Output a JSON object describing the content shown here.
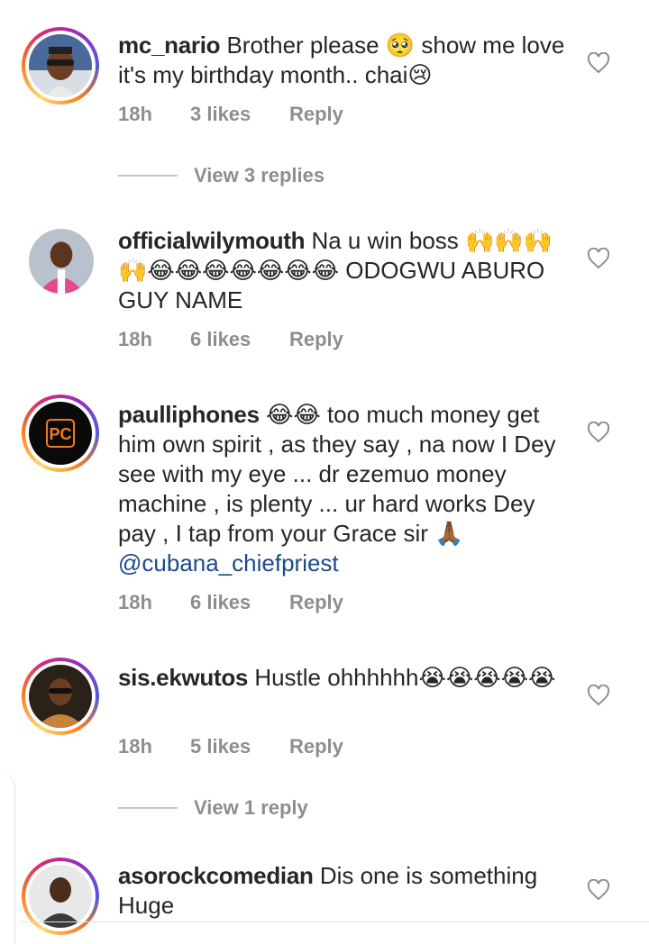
{
  "comments": [
    {
      "username": "mc_nario",
      "text": " Brother please 🥺 show me love it's my birthday month.. chai😢",
      "time": "18h",
      "likes": "3 likes",
      "reply": "Reply",
      "has_story_ring": true
    },
    {
      "username": "officialwilymouth",
      "text": " Na u win boss 🙌🙌🙌🙌😂😂😂😂😂😂😂 ODOGWU ABURO GUY NAME",
      "time": "18h",
      "likes": "6 likes",
      "reply": "Reply",
      "has_story_ring": false
    },
    {
      "username": "paulliphones",
      "text": " 😂😂 too much money get him own spirit , as they say , na now I Dey see with my eye ... dr ezemuo money machine , is plenty ... ur hard works Dey pay , I tap from your Grace sir 🙏🏾 ",
      "mention": "@cubana_chiefpriest",
      "time": "18h",
      "likes": "6 likes",
      "reply": "Reply",
      "has_story_ring": true
    },
    {
      "username": "sis.ekwutos",
      "text": " Hustle ohhhhhh😭😭😭😭😭",
      "time": "18h",
      "likes": "5 likes",
      "reply": "Reply",
      "has_story_ring": true
    },
    {
      "username": "asorockcomedian",
      "text": " Dis one is something Huge",
      "has_story_ring": true
    }
  ],
  "view_replies": {
    "first": "View 3 replies",
    "second": "View 1 reply"
  },
  "icons": {
    "like": "heart-outline-icon"
  },
  "colors": {
    "text": "#262626",
    "meta": "#8e8e8e",
    "mention": "#1a4a8c"
  }
}
